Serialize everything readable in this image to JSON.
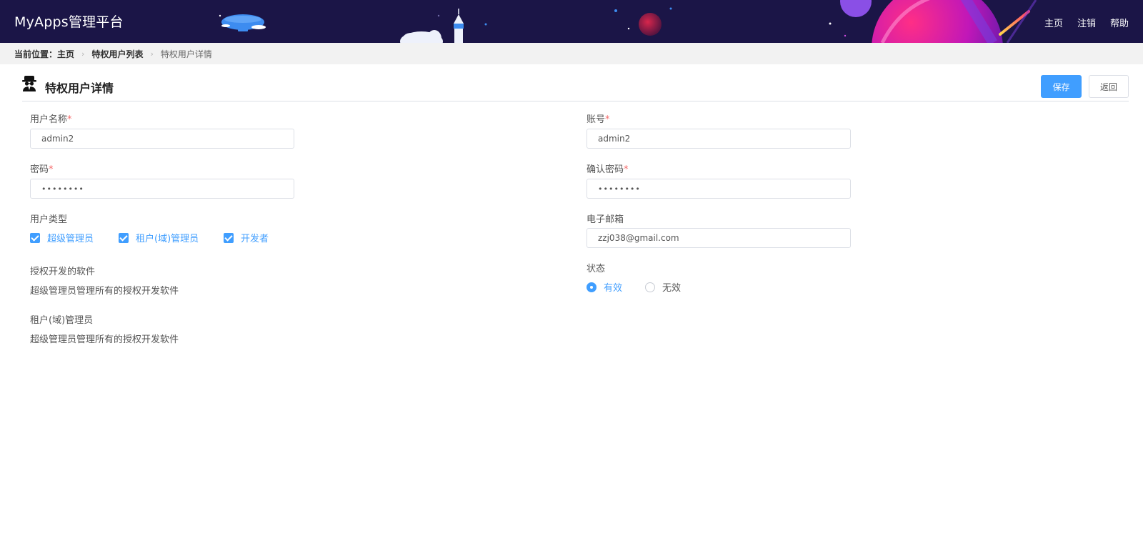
{
  "header": {
    "app_title": "MyApps管理平台",
    "nav": [
      {
        "label": "主页"
      },
      {
        "label": "注销"
      },
      {
        "label": "帮助"
      }
    ]
  },
  "breadcrumb": {
    "prefix": "当前位置：",
    "items": [
      "主页",
      "特权用户列表",
      "特权用户详情"
    ]
  },
  "page": {
    "title": "特权用户详情",
    "icon": "spy-user-icon",
    "save_label": "保存",
    "back_label": "返回"
  },
  "form": {
    "required_mark": "*",
    "username": {
      "label": "用户名称",
      "value": "admin2"
    },
    "account": {
      "label": "账号",
      "value": "admin2"
    },
    "password": {
      "label": "密码",
      "value": "••••••••"
    },
    "confirm_password": {
      "label": "确认密码",
      "value": "••••••••"
    },
    "user_type": {
      "label": "用户类型",
      "options": [
        {
          "label": "超级管理员",
          "checked": true
        },
        {
          "label": "租户(域)管理员",
          "checked": true
        },
        {
          "label": "开发者",
          "checked": true
        }
      ]
    },
    "email": {
      "label": "电子邮箱",
      "value": "zzj038@gmail.com"
    },
    "authorized_software": {
      "label": "授权开发的软件",
      "value": "超级管理员管理所有的授权开发软件"
    },
    "status": {
      "label": "状态",
      "options": [
        {
          "label": "有效",
          "selected": true
        },
        {
          "label": "无效",
          "selected": false
        }
      ]
    },
    "tenant_admin": {
      "label": "租户(域)管理员",
      "value": "超级管理员管理所有的授权开发软件"
    }
  },
  "colors": {
    "header_bg": "#1b1547",
    "accent": "#409eff",
    "required": "#f56c6c"
  }
}
